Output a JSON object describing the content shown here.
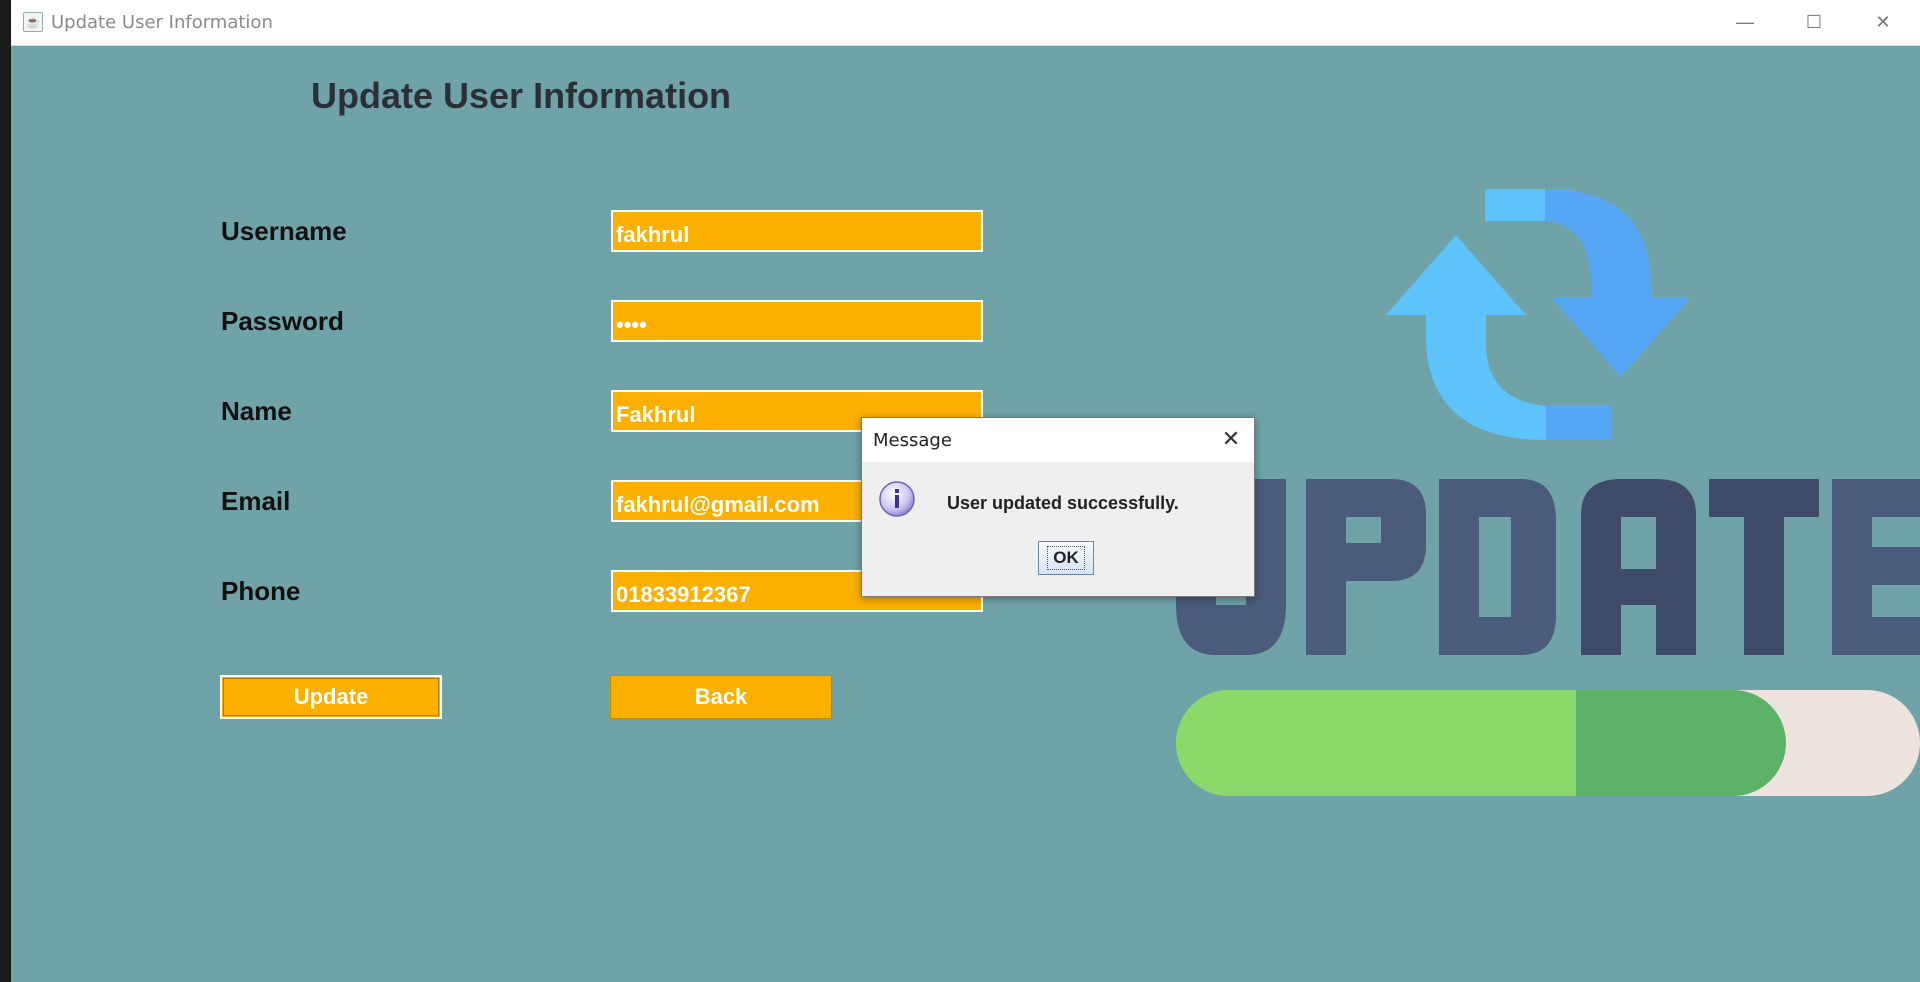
{
  "window": {
    "title": "Update User Information",
    "controls": {
      "minimize": "—",
      "maximize": "☐",
      "close": "✕"
    }
  },
  "form": {
    "heading": "Update User Information",
    "fields": [
      {
        "label": "Username",
        "value": "fakhrul"
      },
      {
        "label": "Password",
        "value": "••••"
      },
      {
        "label": "Name",
        "value": "Fakhrul"
      },
      {
        "label": "Email",
        "value": "fakhrul@gmail.com"
      },
      {
        "label": "Phone",
        "value": "01833912367"
      }
    ],
    "buttons": {
      "update": "Update",
      "back": "Back"
    }
  },
  "illustration": {
    "text": "UPDATE",
    "progress_fraction": 0.82
  },
  "dialog": {
    "title": "Message",
    "message": "User updated successfully.",
    "ok_label": "OK",
    "close": "✕"
  },
  "colors": {
    "background": "#6fa3a8",
    "field": "#fbb000",
    "arrow_light": "#5ec2fb",
    "arrow_dark": "#56a6f6",
    "letters": "#4a5b7c",
    "progress_fill": "#8cd96b",
    "progress_dark": "#5cb368",
    "progress_track": "#ede4df"
  }
}
